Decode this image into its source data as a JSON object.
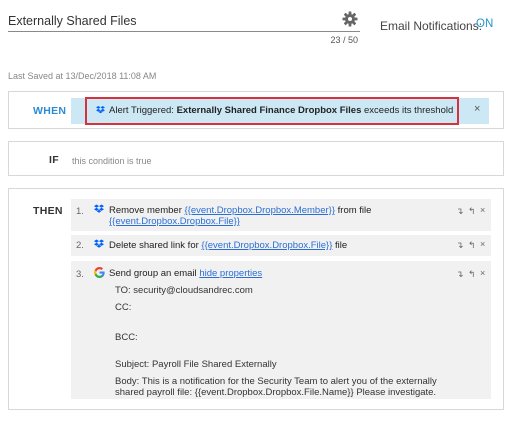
{
  "header": {
    "rule_name": "Externally Shared Files",
    "char_count": "23 / 50",
    "email_notifications_label": "Email Notifications:",
    "email_notifications_state": "ON",
    "last_saved": "Last Saved at 13/Dec/2018 11:08 AM"
  },
  "when": {
    "label": "WHEN",
    "trigger_prefix": "Alert Triggered:",
    "trigger_name": "Externally Shared Finance Dropbox Files",
    "trigger_suffix": "exceeds its threshold",
    "close": "×"
  },
  "if": {
    "label": "IF",
    "text": "this condition is true"
  },
  "then": {
    "label": "THEN",
    "actions": [
      {
        "num": "1.",
        "text_prefix": "Remove member",
        "link1": "{{event.Dropbox.Dropbox.Member}}",
        "mid": "from file",
        "link2": "{{event.Dropbox.Dropbox.File}}"
      },
      {
        "num": "2.",
        "text_prefix": "Delete shared link for",
        "link1": "{{event.Dropbox.Dropbox.File}}",
        "suffix": "file"
      },
      {
        "num": "3.",
        "text_prefix": "Send group an email",
        "link1": "hide properties",
        "to": "TO:   security@cloudsandrec.com",
        "cc": "CC:",
        "bcc": "BCC:",
        "subject": "Subject:   Payroll File Shared Externally",
        "body_line1": "Body:   This is a notification for the Security Team to alert you of the externally",
        "body_line2": "shared payroll file: {{event.Dropbox.Dropbox.File.Name}} Please investigate."
      }
    ],
    "controls": {
      "down": "↴",
      "up": "↰",
      "remove": "×"
    }
  }
}
